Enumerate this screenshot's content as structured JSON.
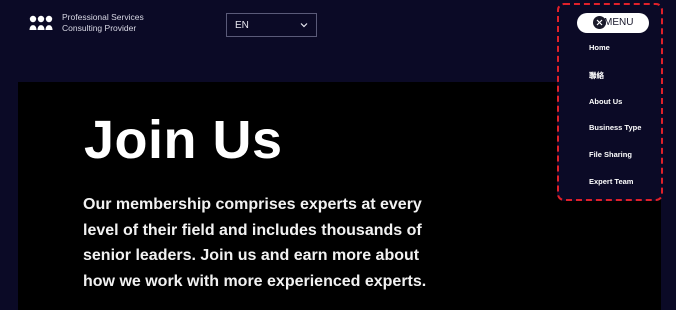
{
  "brand": {
    "line1": "Professional Services",
    "line2": "Consulting Provider",
    "logo_icon": "people-logo-icon"
  },
  "language": {
    "selected": "EN",
    "icon": "chevron-down-icon"
  },
  "hero": {
    "title": "Join Us",
    "body": "Our membership comprises experts at every level of their field and includes thousands of senior leaders. Join us and earn more about how we work with more experienced experts."
  },
  "menu": {
    "button_label": "MENU",
    "close_icon": "close-icon",
    "items": [
      {
        "label": "Home"
      },
      {
        "label": "聯絡"
      },
      {
        "label": "About Us"
      },
      {
        "label": "Business Type"
      },
      {
        "label": "File Sharing"
      },
      {
        "label": "Expert Team"
      }
    ]
  },
  "colors": {
    "background": "#0b0a26",
    "hero_background": "#000000",
    "highlight_border": "#e0202a"
  }
}
